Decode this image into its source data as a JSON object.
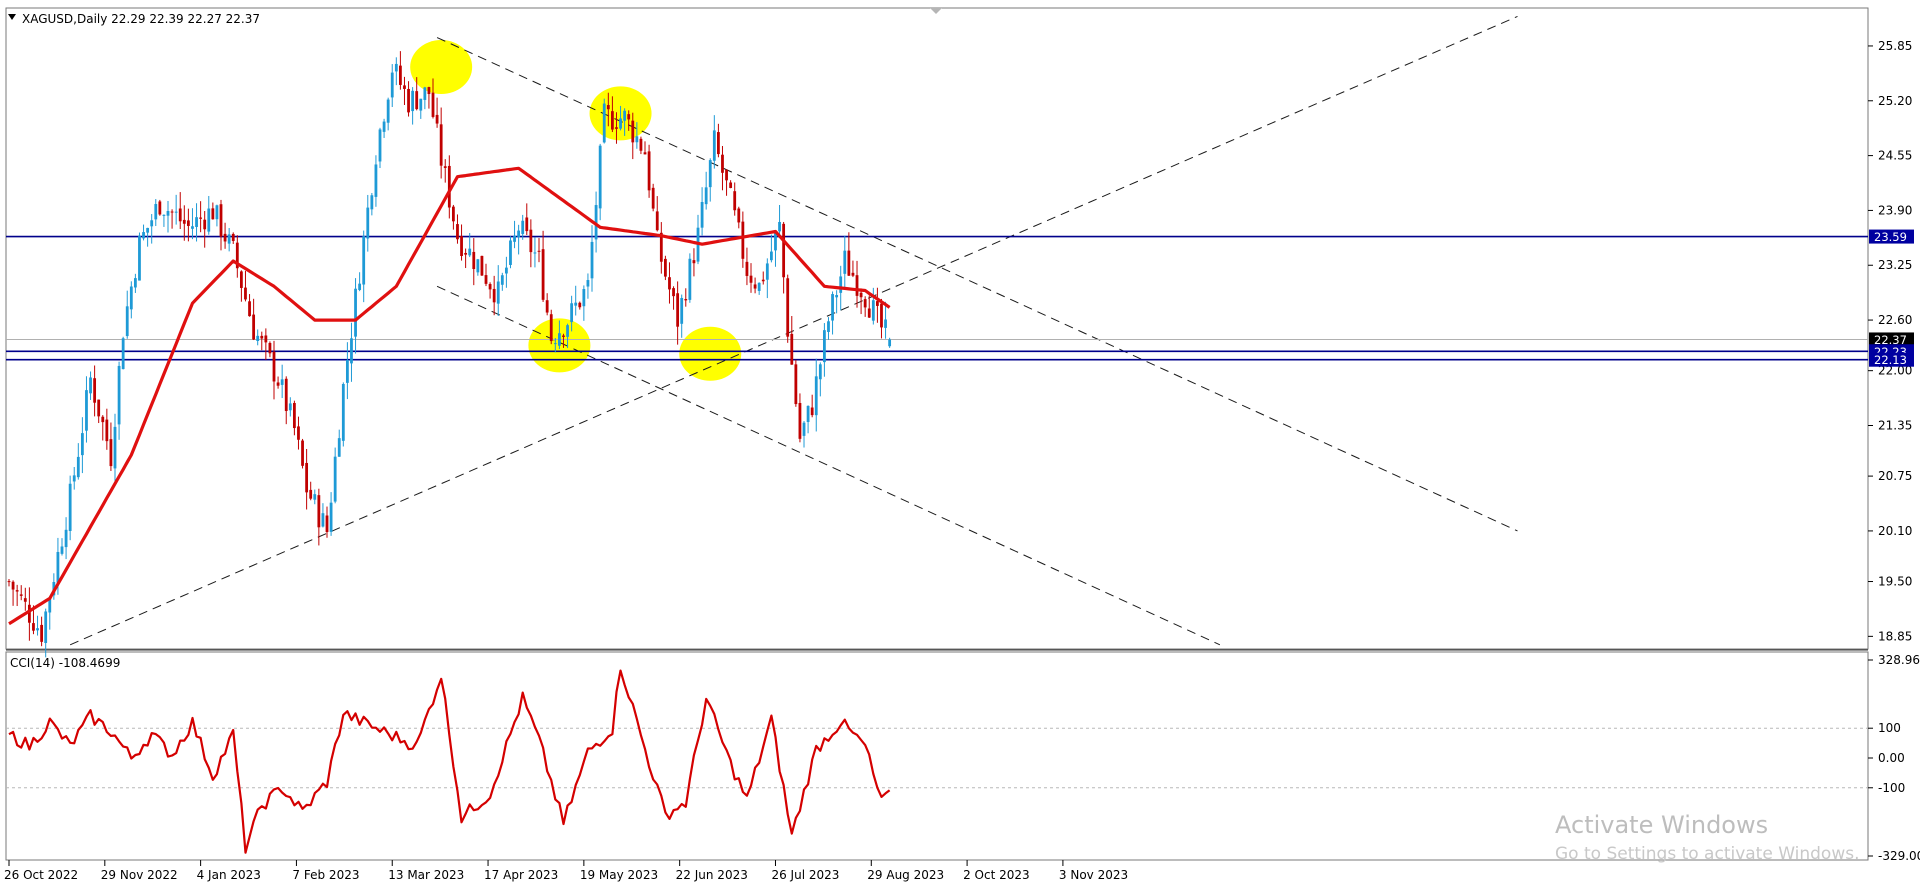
{
  "window": {
    "symbol_info": "XAGUSD,Daily  22.29 22.39 22.27 22.37",
    "indicator_info": "CCI(14) -108.4699"
  },
  "watermark": {
    "line1": "Activate Windows",
    "line2": "Go to Settings to activate Windows."
  },
  "colors": {
    "up_candle": "#1e9ad6",
    "down_candle": "#c00000",
    "moving_average": "#e01010",
    "horizontal_levels": "#00008b",
    "cci_line": "#d40000",
    "highlight": "#ffff00",
    "trendline": "#1a1a1a"
  },
  "chart_data": [
    {
      "type": "candlestick",
      "symbol": "XAGUSD",
      "timeframe": "Daily",
      "last_bar": {
        "open": 22.29,
        "high": 22.39,
        "low": 22.27,
        "close": 22.37
      },
      "x_ticks": [
        "26 Oct 2022",
        "29 Nov 2022",
        "4 Jan 2023",
        "7 Feb 2023",
        "13 Mar 2023",
        "17 Apr 2023",
        "19 May 2023",
        "22 Jun 2023",
        "26 Jul 2023",
        "29 Aug 2023",
        "2 Oct 2023",
        "3 Nov 2023"
      ],
      "y_ticks": [
        25.85,
        25.2,
        24.55,
        23.9,
        23.25,
        22.6,
        22.0,
        21.35,
        20.75,
        20.1,
        19.5,
        18.85
      ],
      "ylim": [
        18.7,
        26.3
      ],
      "price_labels": [
        {
          "label": "23.59",
          "value": 23.59,
          "style": "level"
        },
        {
          "label": "22.37",
          "value": 22.37,
          "style": "current"
        },
        {
          "label": "22.23",
          "value": 22.23,
          "style": "level"
        },
        {
          "label": "22.13",
          "value": 22.13,
          "style": "level"
        }
      ],
      "horizontal_levels": [
        23.59,
        22.23,
        22.13
      ],
      "price_path": [
        [
          0,
          19.5
        ],
        [
          8,
          18.9
        ],
        [
          15,
          20.5
        ],
        [
          20,
          21.9
        ],
        [
          25,
          21.0
        ],
        [
          28,
          22.5
        ],
        [
          32,
          23.5
        ],
        [
          37,
          24.0
        ],
        [
          44,
          23.7
        ],
        [
          50,
          23.9
        ],
        [
          55,
          23.4
        ],
        [
          60,
          22.5
        ],
        [
          66,
          21.9
        ],
        [
          70,
          21.3
        ],
        [
          73,
          20.6
        ],
        [
          78,
          20.1
        ],
        [
          82,
          21.8
        ],
        [
          86,
          23.2
        ],
        [
          90,
          24.6
        ],
        [
          94,
          25.6
        ],
        [
          98,
          25.2
        ],
        [
          103,
          25.3
        ],
        [
          106,
          24.5
        ],
        [
          110,
          23.6
        ],
        [
          116,
          23.2
        ],
        [
          120,
          22.9
        ],
        [
          125,
          23.7
        ],
        [
          130,
          23.3
        ],
        [
          133,
          22.4
        ],
        [
          137,
          22.6
        ],
        [
          142,
          23.0
        ],
        [
          146,
          25.0
        ],
        [
          151,
          25.0
        ],
        [
          156,
          24.6
        ],
        [
          159,
          23.5
        ],
        [
          164,
          22.6
        ],
        [
          169,
          23.6
        ],
        [
          173,
          24.7
        ],
        [
          177,
          24.0
        ],
        [
          181,
          23.2
        ],
        [
          184,
          23.0
        ],
        [
          189,
          23.7
        ],
        [
          191,
          22.5
        ],
        [
          194,
          21.2
        ],
        [
          197,
          21.6
        ],
        [
          201,
          22.6
        ],
        [
          205,
          23.3
        ],
        [
          210,
          22.9
        ],
        [
          214,
          22.5
        ],
        [
          216,
          22.37
        ]
      ],
      "moving_average": [
        [
          0,
          19.0
        ],
        [
          10,
          19.3
        ],
        [
          30,
          21.0
        ],
        [
          45,
          22.8
        ],
        [
          55,
          23.3
        ],
        [
          65,
          23.0
        ],
        [
          75,
          22.6
        ],
        [
          85,
          22.6
        ],
        [
          95,
          23.0
        ],
        [
          110,
          24.3
        ],
        [
          125,
          24.4
        ],
        [
          145,
          23.7
        ],
        [
          160,
          23.6
        ],
        [
          170,
          23.5
        ],
        [
          188,
          23.65
        ],
        [
          200,
          23.0
        ],
        [
          210,
          22.95
        ],
        [
          216,
          22.75
        ]
      ],
      "trendlines": [
        {
          "style": "dashed",
          "from": [
            105,
            25.95
          ],
          "to": [
            370,
            20.1
          ]
        },
        {
          "style": "dashed",
          "from": [
            105,
            23.0
          ],
          "to": [
            297,
            18.75
          ]
        },
        {
          "style": "dashed",
          "from": [
            15,
            18.75
          ],
          "to": [
            370,
            26.2
          ]
        }
      ],
      "highlights": [
        [
          106,
          25.6
        ],
        [
          150,
          25.05
        ],
        [
          135,
          22.3
        ],
        [
          172,
          22.2
        ]
      ]
    },
    {
      "type": "line",
      "indicator": "CCI(14)",
      "current_value": -108.4699,
      "y_ticks": [
        {
          "label": "328.964",
          "value": 328.964
        },
        {
          "label": "100",
          "value": 100
        },
        {
          "label": "0.00",
          "value": 0
        },
        {
          "label": "-100",
          "value": -100
        },
        {
          "label": "-329.000",
          "value": -329.0
        }
      ],
      "ylim": [
        -329.0,
        328.964
      ],
      "reference_levels": [
        100,
        -100
      ],
      "values": [
        [
          0,
          80
        ],
        [
          5,
          40
        ],
        [
          10,
          120
        ],
        [
          15,
          40
        ],
        [
          20,
          140
        ],
        [
          25,
          90
        ],
        [
          30,
          0
        ],
        [
          35,
          80
        ],
        [
          40,
          10
        ],
        [
          45,
          120
        ],
        [
          50,
          -60
        ],
        [
          55,
          80
        ],
        [
          58,
          -300
        ],
        [
          62,
          -160
        ],
        [
          67,
          -100
        ],
        [
          72,
          -180
        ],
        [
          78,
          -80
        ],
        [
          82,
          150
        ],
        [
          90,
          100
        ],
        [
          100,
          40
        ],
        [
          106,
          280
        ],
        [
          111,
          -200
        ],
        [
          118,
          -120
        ],
        [
          126,
          200
        ],
        [
          130,
          60
        ],
        [
          136,
          -220
        ],
        [
          142,
          20
        ],
        [
          148,
          100
        ],
        [
          150,
          310
        ],
        [
          156,
          30
        ],
        [
          161,
          -190
        ],
        [
          166,
          -150
        ],
        [
          171,
          200
        ],
        [
          177,
          -20
        ],
        [
          181,
          -140
        ],
        [
          187,
          130
        ],
        [
          192,
          -260
        ],
        [
          198,
          30
        ],
        [
          204,
          120
        ],
        [
          210,
          40
        ],
        [
          214,
          -150
        ],
        [
          216,
          -108.47
        ]
      ]
    }
  ]
}
